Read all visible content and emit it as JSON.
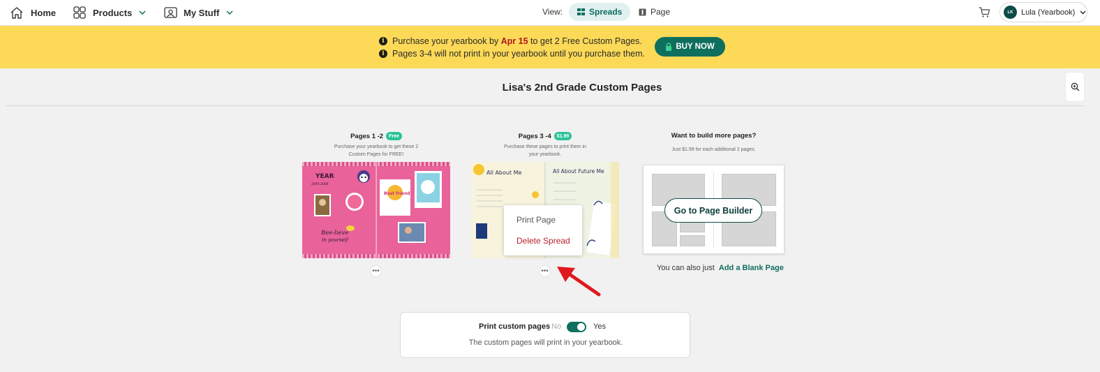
{
  "nav": {
    "home": "Home",
    "products": "Products",
    "my_stuff": "My Stuff",
    "view_label": "View:",
    "view_spreads": "Spreads",
    "view_page": "Page",
    "avatar_initials": "LK",
    "account_name": "Lula (Yearbook)"
  },
  "banner": {
    "line1_prefix": "Purchase your yearbook by ",
    "line1_date": "Apr 15",
    "line1_suffix": " to get 2 Free Custom Pages.",
    "line2": "Pages 3-4 will not print in your yearbook until you purchase them.",
    "buy_label": "BUY NOW",
    "colors": {
      "background": "#fcd957",
      "button": "#0e6f5e",
      "date": "#b0161b"
    }
  },
  "page_title": "Lisa's 2nd Grade Custom Pages",
  "spreads": [
    {
      "title": "Pages 1 -2",
      "badge": "Free",
      "subtitle_1": "Purchase your yearbook to get these 2",
      "subtitle_2": "Custom Pages for FREE!",
      "thumb_text_1": "YEAR",
      "thumb_text_2": "2005-2006",
      "thumb_text_3": "Bee-lieve",
      "thumb_text_4": "in yourself",
      "thumb_text_5": "Best friend"
    },
    {
      "title": "Pages 3 -4",
      "badge": "$1.99",
      "subtitle_1": "Purchase these pages to print them in",
      "subtitle_2": "your yearbook.",
      "thumb_text_left": "All About Me",
      "thumb_text_right": "All About Future Me"
    }
  ],
  "context_menu": {
    "print": "Print Page",
    "delete": "Delete Spread"
  },
  "builder": {
    "title": "Want to build more pages?",
    "subtitle": "Just $1.99 for each additional 2 pages.",
    "button": "Go to Page Builder",
    "blank_prefix": "You can also just ",
    "blank_link": "Add a Blank Page"
  },
  "print_panel": {
    "label": "Print custom pages",
    "no": "No",
    "yes": "Yes",
    "enabled": true,
    "description": "The custom pages will print in your yearbook."
  },
  "icons": {
    "home": "home-icon",
    "products": "grid-icon",
    "my_stuff": "person-icon",
    "cart": "cart-icon",
    "zoom": "zoom-in-icon",
    "info": "info-icon",
    "lock": "lock-icon",
    "more": "more-dots-icon",
    "arrow": "red-arrow-icon"
  }
}
